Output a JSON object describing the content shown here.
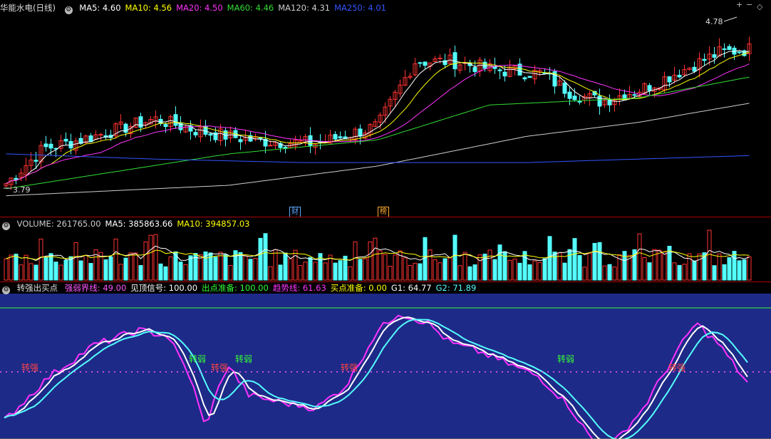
{
  "price_panel": {
    "stock_name": "华能水电(日线)",
    "ma": [
      {
        "label": "MA5: 4.60",
        "color": "#ffffff"
      },
      {
        "label": "MA10: 4.56",
        "color": "#ffff00"
      },
      {
        "label": "MA20: 4.50",
        "color": "#ff33ff"
      },
      {
        "label": "MA60: 4.46",
        "color": "#33dd33"
      },
      {
        "label": "MA120: 4.31",
        "color": "#cccccc"
      },
      {
        "label": "MA250: 4.01",
        "color": "#3355ff"
      }
    ],
    "high_label": "4.78",
    "low_label": "3.79",
    "event_badges": [
      {
        "text": "财",
        "color": "#5fa8ff"
      },
      {
        "text": "榜",
        "color": "#ffaa33"
      }
    ],
    "colors": {
      "up": "#ff3232",
      "down": "#54ffff"
    }
  },
  "volume_panel": {
    "items": [
      {
        "label": "VOLUME: 261765.00",
        "color": "#cccccc"
      },
      {
        "label": "MA5: 385863.66",
        "color": "#ffffff"
      },
      {
        "label": "MA10: 394857.03",
        "color": "#ffff00"
      }
    ]
  },
  "indicator_panel": {
    "name": "转强出买点",
    "items": [
      {
        "label": "强弱界线: 49.00",
        "color": "#ff55ff"
      },
      {
        "label": "见顶信号: 100.00",
        "color": "#ffffff"
      },
      {
        "label": "出点准备: 100.00",
        "color": "#33ff33"
      },
      {
        "label": "趋势线: 61.63",
        "color": "#ff33ff"
      },
      {
        "label": "买点准备: 0.00",
        "color": "#ffff00"
      },
      {
        "label": "G1: 64.77",
        "color": "#ffffff"
      },
      {
        "label": "G2: 71.89",
        "color": "#54ffff"
      }
    ],
    "tags": {
      "strong": "转强",
      "weak": "转弱"
    },
    "background": "#1e2a88"
  },
  "controls": {
    "zoom_in": "+",
    "zoom_out": "−",
    "diamond": "◇"
  }
}
